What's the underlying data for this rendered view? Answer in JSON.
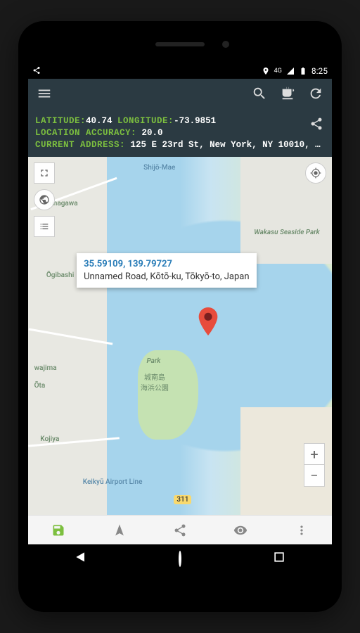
{
  "status": {
    "network": "4G",
    "time": "8:25"
  },
  "info": {
    "lat_label": "Latitude:",
    "lat_val": "40.74",
    "lon_label": "Longitude:",
    "lon_val": "-73.9851",
    "acc_label": "Location Accuracy:",
    "acc_val": "20.0",
    "addr_label": "Current Address:",
    "addr_val": "125 E 23rd St, New York, NY 10010, U..."
  },
  "popup": {
    "coords": "35.59109, 139.79727",
    "address": "Unnamed Road, Kōtō-ku, Tōkyō-to, Japan"
  },
  "map_labels": {
    "shinagawa": "Shinagawa",
    "shijomae": "Shijō-Mae",
    "wakasu": "Wakasu Seaside Park",
    "park": "Park",
    "park_jp": "城南島\n海浜公園",
    "ogibashi": "Ōgibashi",
    "wajima": "wajima",
    "kojiya": "Kojiya",
    "keikyu": "Keikyū Airport Line",
    "road": "311",
    "ota": "Ōta"
  },
  "zoom": {
    "in": "+",
    "out": "−"
  }
}
